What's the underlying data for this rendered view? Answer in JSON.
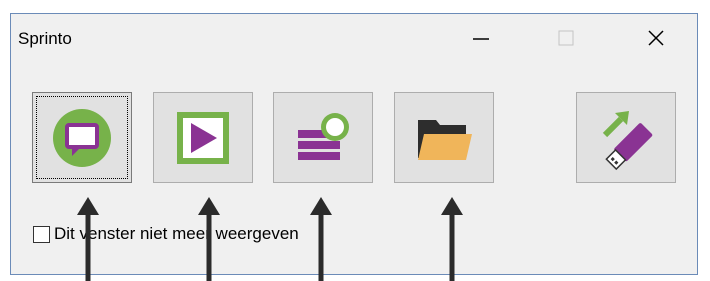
{
  "window": {
    "title": "Sprinto"
  },
  "toolbar": {
    "buttons": [
      {
        "name": "speech",
        "icon": "speech-bubble-icon",
        "focused": true
      },
      {
        "name": "play",
        "icon": "play-icon",
        "focused": false
      },
      {
        "name": "list",
        "icon": "list-circle-icon",
        "focused": false
      },
      {
        "name": "open-folder",
        "icon": "folder-icon",
        "focused": false
      },
      {
        "name": "usb",
        "icon": "usb-stick-icon",
        "focused": false
      }
    ]
  },
  "options": {
    "dont_show_label": "Dit venster niet meer weergeven",
    "dont_show_checked": false
  },
  "colors": {
    "green": "#77b24a",
    "purple": "#8a3393",
    "folder_orange": "#f0b55a",
    "folder_dark": "#2d2d2d"
  }
}
